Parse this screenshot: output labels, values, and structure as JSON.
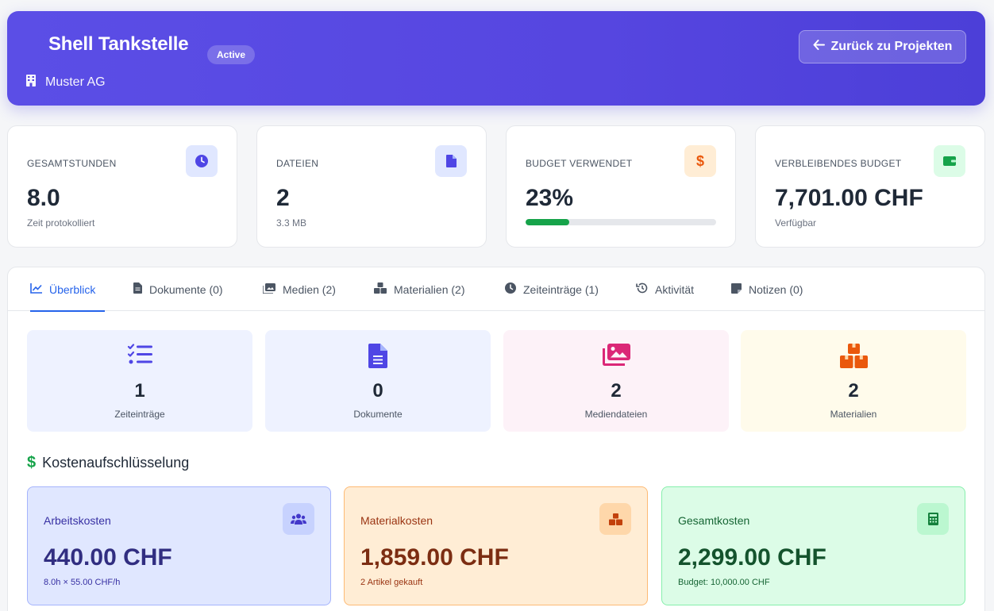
{
  "header": {
    "title": "Shell Tankstelle",
    "status": "Active",
    "company": "Muster AG",
    "back_label": "Zurück zu Projekten"
  },
  "stats": [
    {
      "label": "GESAMTSTUNDEN",
      "value": "8.0",
      "sub": "Zeit protokolliert",
      "icon": "clock-icon",
      "color": "#4f46e5"
    },
    {
      "label": "DATEIEN",
      "value": "2",
      "sub": "3.3 MB",
      "icon": "file-icon",
      "color": "#4f46e5"
    },
    {
      "label": "BUDGET VERWENDET",
      "value": "23%",
      "progress": 0.23,
      "icon": "dollar-icon",
      "color": "#ea580c"
    },
    {
      "label": "VERBLEIBENDES BUDGET",
      "value": "7,701.00 CHF",
      "sub": "Verfügbar",
      "icon": "wallet-icon",
      "color": "#16a34a"
    }
  ],
  "tabs": [
    {
      "label": "Überblick",
      "icon": "chart-line-icon",
      "active": true
    },
    {
      "label": "Dokumente (0)",
      "icon": "file-icon"
    },
    {
      "label": "Medien (2)",
      "icon": "images-icon"
    },
    {
      "label": "Materialien (2)",
      "icon": "boxes-icon"
    },
    {
      "label": "Zeiteinträge (1)",
      "icon": "clock-icon"
    },
    {
      "label": "Aktivität",
      "icon": "history-icon"
    },
    {
      "label": "Notizen (0)",
      "icon": "sticky-note-icon"
    }
  ],
  "summary": [
    {
      "value": "1",
      "label": "Zeiteinträge",
      "icon": "tasks-icon"
    },
    {
      "value": "0",
      "label": "Dokumente",
      "icon": "file-alt-icon"
    },
    {
      "value": "2",
      "label": "Mediendateien",
      "icon": "images-icon"
    },
    {
      "value": "2",
      "label": "Materialien",
      "icon": "boxes-icon"
    }
  ],
  "cost_section": {
    "title": "Kostenaufschlüsselung"
  },
  "costs": [
    {
      "label": "Arbeitskosten",
      "value": "440.00 CHF",
      "sub": "8.0h × 55.00 CHF/h",
      "icon": "users-icon"
    },
    {
      "label": "Materialkosten",
      "value": "1,859.00 CHF",
      "sub": "2 Artikel gekauft",
      "icon": "boxes-icon"
    },
    {
      "label": "Gesamtkosten",
      "value": "2,299.00 CHF",
      "sub": "Budget: 10,000.00 CHF",
      "icon": "calculator-icon"
    }
  ]
}
